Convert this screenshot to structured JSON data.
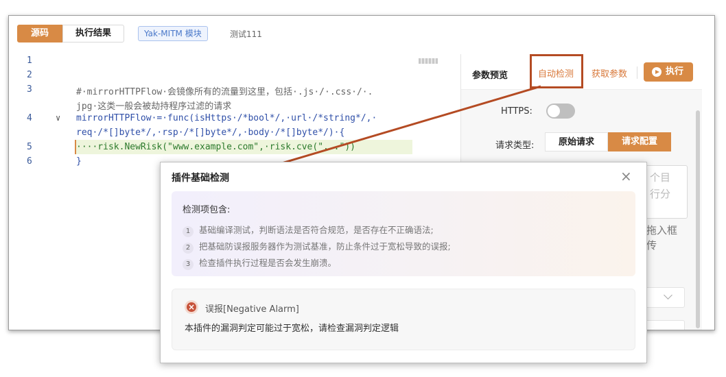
{
  "header": {
    "tab_source": "源码",
    "tab_result": "执行结果",
    "tag": "Yak-MITM 模块",
    "plugin_name": "测试111"
  },
  "editor": {
    "lines": [
      {
        "num": "1",
        "text": ""
      },
      {
        "num": "2",
        "text": ""
      },
      {
        "num": "3",
        "text": "#·mirrorHTTPFlow·会镜像所有的流量到这里，包括·.js·/·.css·/·."
      },
      {
        "num": "",
        "text": "jpg·这类一般会被劫持程序过滤的请求"
      },
      {
        "num": "4",
        "text": "mirrorHTTPFlow·=·func(isHttps·/*bool*/,·url·/*string*/,·"
      },
      {
        "num": "",
        "text": "req·/*[]byte*/,·rsp·/*[]byte*/,·body·/*[]byte*/)·{"
      },
      {
        "num": "5",
        "text": "····risk.NewRisk(\"www.example.com\",·risk.cve(\"...\"))"
      },
      {
        "num": "6",
        "text": "}"
      }
    ]
  },
  "panel": {
    "preview": "参数预览",
    "auto_detect": "自动检测",
    "get_params": "获取参数",
    "execute": "执行",
    "https_label": "HTTPS:",
    "request_type_label": "请求类型:",
    "seg_raw": "原始请求",
    "seg_config": "请求配置",
    "textarea_line1": "个目",
    "textarea_line2": "行分",
    "drag_line1": "拖入框",
    "drag_line2": "传"
  },
  "popup": {
    "title": "插件基础检测",
    "close": "×",
    "info_head": "检测项包含:",
    "items": [
      {
        "num": "1",
        "text": "基础编译测试，判断语法是否符合规范，是否存在不正确语法;"
      },
      {
        "num": "2",
        "text": "把基础防误报服务器作为测试基准，防止条件过于宽松导致的误报;"
      },
      {
        "num": "3",
        "text": "检查插件执行过程是否会发生崩溃。"
      }
    ],
    "alarm_title": "误报[Negative Alarm]",
    "alarm_body": "本插件的漏洞判定可能过于宽松，请检查漏洞判定逻辑"
  },
  "colors": {
    "accent": "#d88a45",
    "annotation": "#b44b23",
    "alarm": "#c7523a"
  }
}
